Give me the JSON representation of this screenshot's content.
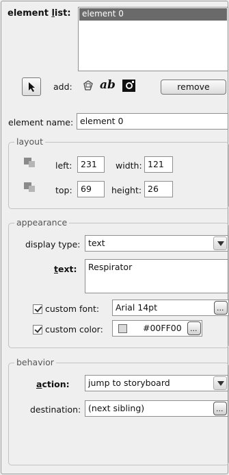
{
  "element_list": {
    "label_prefix": "element ",
    "label_underlined": "l",
    "label_suffix": "ist:",
    "items": [
      "element 0"
    ]
  },
  "toolbar": {
    "add_label": "add:",
    "text_tool_glyph": "ab",
    "remove_label": "remove"
  },
  "element_name": {
    "label": "element name:",
    "value": "element 0"
  },
  "layout": {
    "title": "layout",
    "left_label": "left:",
    "left_value": "231",
    "width_label": "width:",
    "width_value": "121",
    "top_label": "top:",
    "top_value": "69",
    "height_label": "height:",
    "height_value": "26"
  },
  "appearance": {
    "title": "appearance",
    "display_type_label": "display type:",
    "display_type_value": "text",
    "text_label_underlined": "t",
    "text_label_rest": "ext:",
    "text_value": "Respirator",
    "custom_font_label": "custom font:",
    "custom_font_value": "Arial 14pt",
    "custom_color_label": "custom color:",
    "custom_color_value": "#00FF00",
    "custom_color_swatch": "#d9d9d9"
  },
  "behavior": {
    "title": "behavior",
    "action_label_underlined": "a",
    "action_label_rest": "ction:",
    "action_value": "jump to storyboard",
    "destination_label": "destination:",
    "destination_value": "(next sibling)"
  },
  "icons": [
    "pointer-icon",
    "shape-tool-icon",
    "text-tool-icon",
    "image-tool-icon",
    "layout-position-icon",
    "layout-size-icon",
    "dropdown-arrow-icon",
    "ellipsis-icon",
    "checkmark-icon"
  ]
}
